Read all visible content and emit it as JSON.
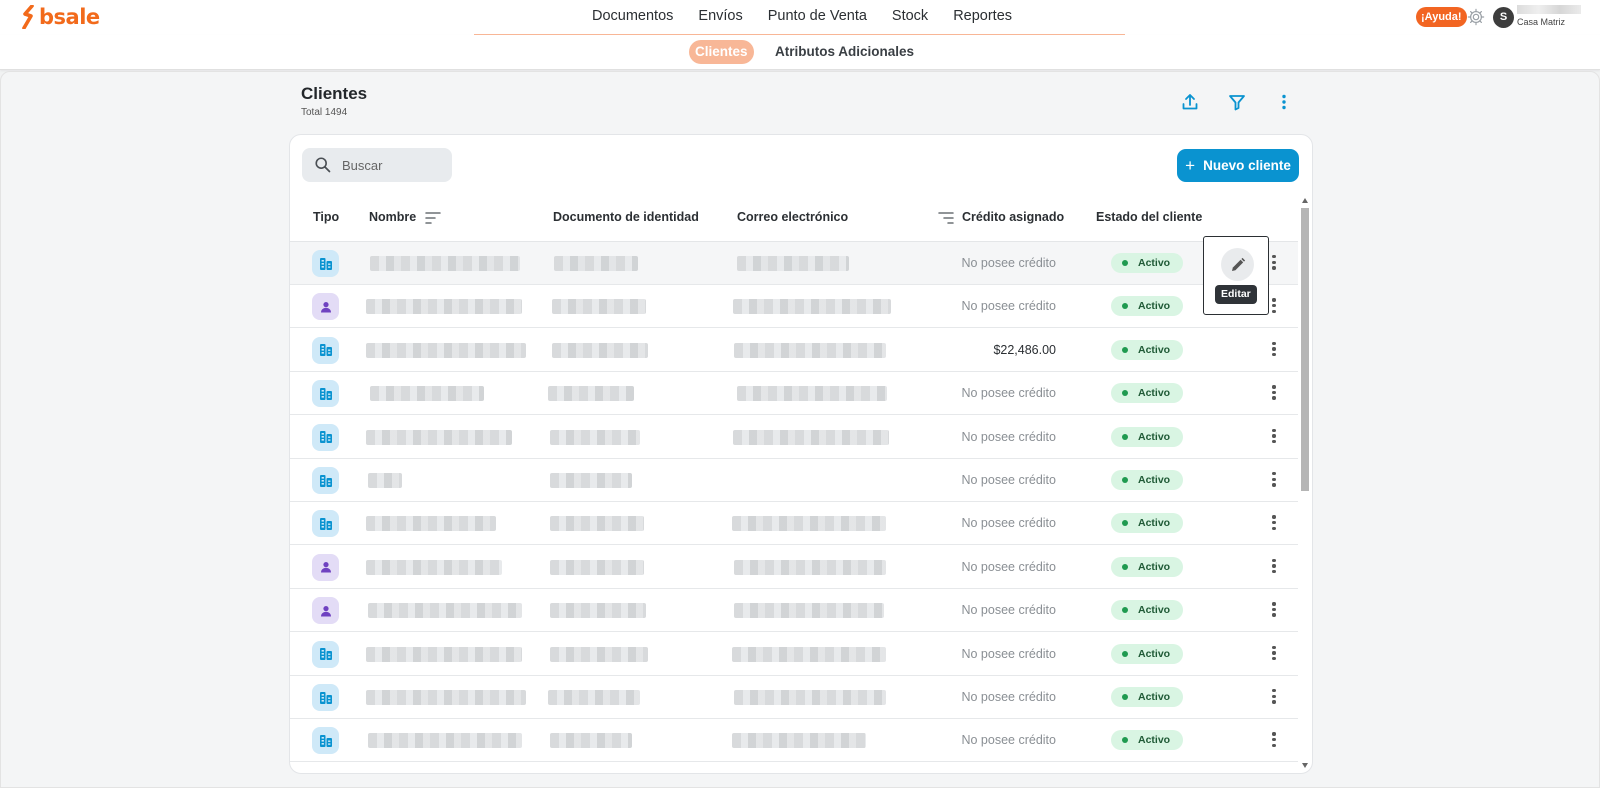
{
  "app": {
    "brand": "bsale"
  },
  "topnav": {
    "items": [
      "Documentos",
      "Envíos",
      "Punto de Venta",
      "Stock",
      "Reportes"
    ],
    "help_label": "¡Ayuda!",
    "avatar_initial": "S",
    "branch": "Casa Matriz"
  },
  "subnav": {
    "active": "Clientes",
    "other": "Atributos Adicionales"
  },
  "page": {
    "title": "Clientes",
    "subtitle": "Total 1494"
  },
  "search": {
    "placeholder": "Buscar"
  },
  "new_button": {
    "label": "Nuevo cliente"
  },
  "table": {
    "headers": {
      "tipo": "Tipo",
      "nombre": "Nombre",
      "documento": "Documento de identidad",
      "correo": "Correo electrónico",
      "credito": "Crédito asignado",
      "estado": "Estado del cliente"
    },
    "rows": [
      {
        "type": "company",
        "credit": "No posee crédito",
        "status": "Activo"
      },
      {
        "type": "person",
        "credit": "No posee crédito",
        "status": "Activo"
      },
      {
        "type": "company",
        "credit": "$22,486.00",
        "status": "Activo"
      },
      {
        "type": "company",
        "credit": "No posee crédito",
        "status": "Activo"
      },
      {
        "type": "company",
        "credit": "No posee crédito",
        "status": "Activo"
      },
      {
        "type": "company",
        "credit": "No posee crédito",
        "status": "Activo"
      },
      {
        "type": "company",
        "credit": "No posee crédito",
        "status": "Activo"
      },
      {
        "type": "person",
        "credit": "No posee crédito",
        "status": "Activo"
      },
      {
        "type": "person",
        "credit": "No posee crédito",
        "status": "Activo"
      },
      {
        "type": "company",
        "credit": "No posee crédito",
        "status": "Activo"
      },
      {
        "type": "company",
        "credit": "No posee crédito",
        "status": "Activo"
      },
      {
        "type": "company",
        "credit": "No posee crédito",
        "status": "Activo"
      }
    ]
  },
  "tooltip": {
    "edit": "Editar"
  },
  "colors": {
    "brand": "#f26a1b",
    "accent": "#0a93d0",
    "status_active_bg": "#d9f5e3",
    "status_active_dot": "#1f9a50"
  },
  "icons": [
    "logo-icon",
    "gear-icon",
    "export-icon",
    "filter-icon",
    "more-vert-icon",
    "search-icon",
    "plus-icon",
    "sort-icon",
    "company-icon",
    "person-icon",
    "edit-pencil-icon"
  ]
}
